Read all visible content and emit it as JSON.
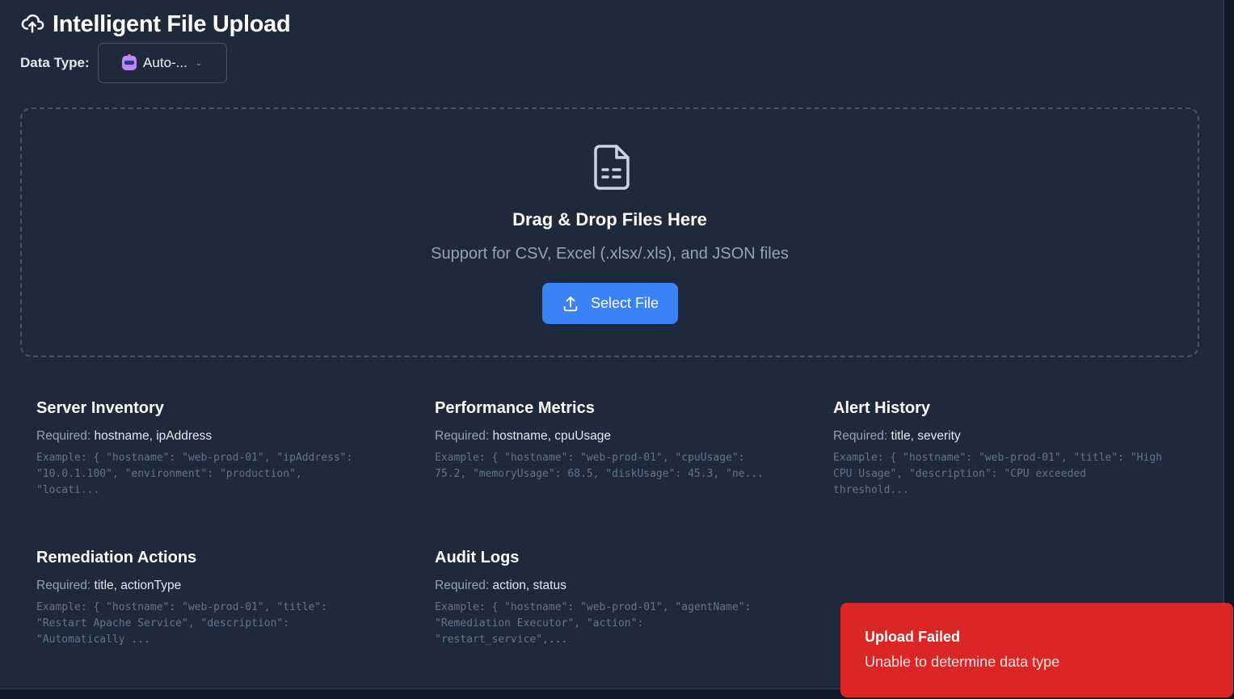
{
  "header": {
    "title": "Intelligent File Upload",
    "icon": "cloud-upload-icon"
  },
  "data_type": {
    "label": "Data Type:",
    "selected": "Auto-...",
    "icon": "robot-icon"
  },
  "dropzone": {
    "icon": "file-document-icon",
    "title": "Drag & Drop Files Here",
    "subtitle": "Support for CSV, Excel (.xlsx/.xls), and JSON files",
    "button_label": "Select File",
    "button_icon": "upload-icon"
  },
  "required_prefix": "Required:",
  "data_types": [
    {
      "name": "Server Inventory",
      "required": "hostname, ipAddress",
      "example_lines": [
        "Example: { \"hostname\": \"web-prod-01\", \"ipAddress\":",
        "\"10.0.1.100\", \"environment\": \"production\",",
        "\"locati..."
      ]
    },
    {
      "name": "Performance Metrics",
      "required": "hostname, cpuUsage",
      "example_lines": [
        "Example: { \"hostname\": \"web-prod-01\", \"cpuUsage\":",
        "75.2, \"memoryUsage\": 68.5, \"diskUsage\": 45.3, \"ne..."
      ]
    },
    {
      "name": "Alert History",
      "required": "title, severity",
      "example_lines": [
        "Example: { \"hostname\": \"web-prod-01\", \"title\": \"High",
        "CPU Usage\", \"description\": \"CPU exceeded",
        "threshold..."
      ]
    },
    {
      "name": "Remediation Actions",
      "required": "title, actionType",
      "example_lines": [
        "Example: { \"hostname\": \"web-prod-01\", \"title\":",
        "\"Restart Apache Service\", \"description\":",
        "\"Automatically ..."
      ]
    },
    {
      "name": "Audit Logs",
      "required": "action, status",
      "example_lines": [
        "Example: { \"hostname\": \"web-prod-01\", \"agentName\":",
        "\"Remediation Executor\", \"action\":",
        "\"restart_service\",..."
      ]
    }
  ],
  "toast": {
    "title": "Upload Failed",
    "message": "Unable to determine data type",
    "color": "#dc2626"
  },
  "colors": {
    "background": "#1e293b",
    "accent": "#3b82f6",
    "error": "#dc2626"
  }
}
